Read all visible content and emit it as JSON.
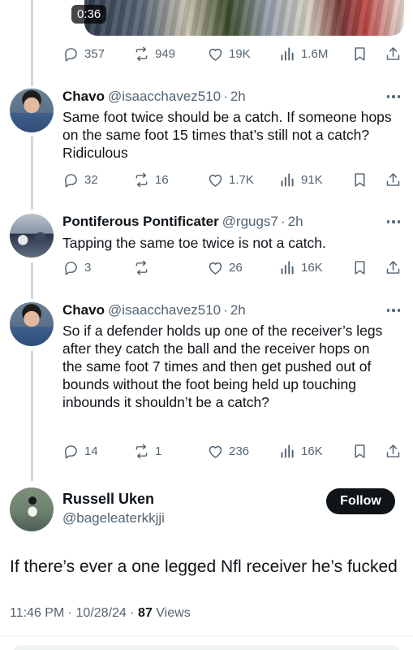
{
  "video": {
    "duration": "0:36"
  },
  "parent_actions": {
    "replies": "357",
    "reposts": "949",
    "likes": "19K",
    "views": "1.6M"
  },
  "replies": [
    {
      "name": "Chavo",
      "handle": "@isaacchavez510",
      "sep": "·",
      "time": "2h",
      "text": "Same foot twice should be a catch. If someone hops on the same foot 15 times that’s still not a catch? Ridiculous",
      "replies": "32",
      "reposts": "16",
      "likes": "1.7K",
      "views": "91K"
    },
    {
      "name": "Pontiferous Pontificater",
      "handle": "@rgugs7",
      "sep": "·",
      "time": "2h",
      "text": "Tapping the same toe twice is not a catch.",
      "replies": "3",
      "reposts": "",
      "likes": "26",
      "views": "16K"
    },
    {
      "name": "Chavo",
      "handle": "@isaacchavez510",
      "sep": "·",
      "time": "2h",
      "text": "So if a defender holds up one of the receiver’s legs after they catch the ball and the receiver hops on the same foot 7 times and then get pushed out of bounds without the foot being held up touching inbounds it shouldn’t be a catch?",
      "replies": "14",
      "reposts": "1",
      "likes": "236",
      "views": "16K"
    }
  ],
  "main": {
    "name": "Russell Uken",
    "handle": "@bageleaterkkjji",
    "follow_label": "Follow",
    "text": "If there’s ever a one legged Nfl receiver he’s fucked",
    "time": "11:46 PM",
    "sep1": "·",
    "date": "10/28/24",
    "sep2": "·",
    "views_count": "87",
    "views_label": "Views"
  },
  "icons": {
    "reply": "reply-icon",
    "repost": "repost-icon",
    "like": "heart-icon",
    "views": "views-icon",
    "bookmark": "bookmark-icon",
    "share": "share-icon",
    "more": "more-icon"
  }
}
